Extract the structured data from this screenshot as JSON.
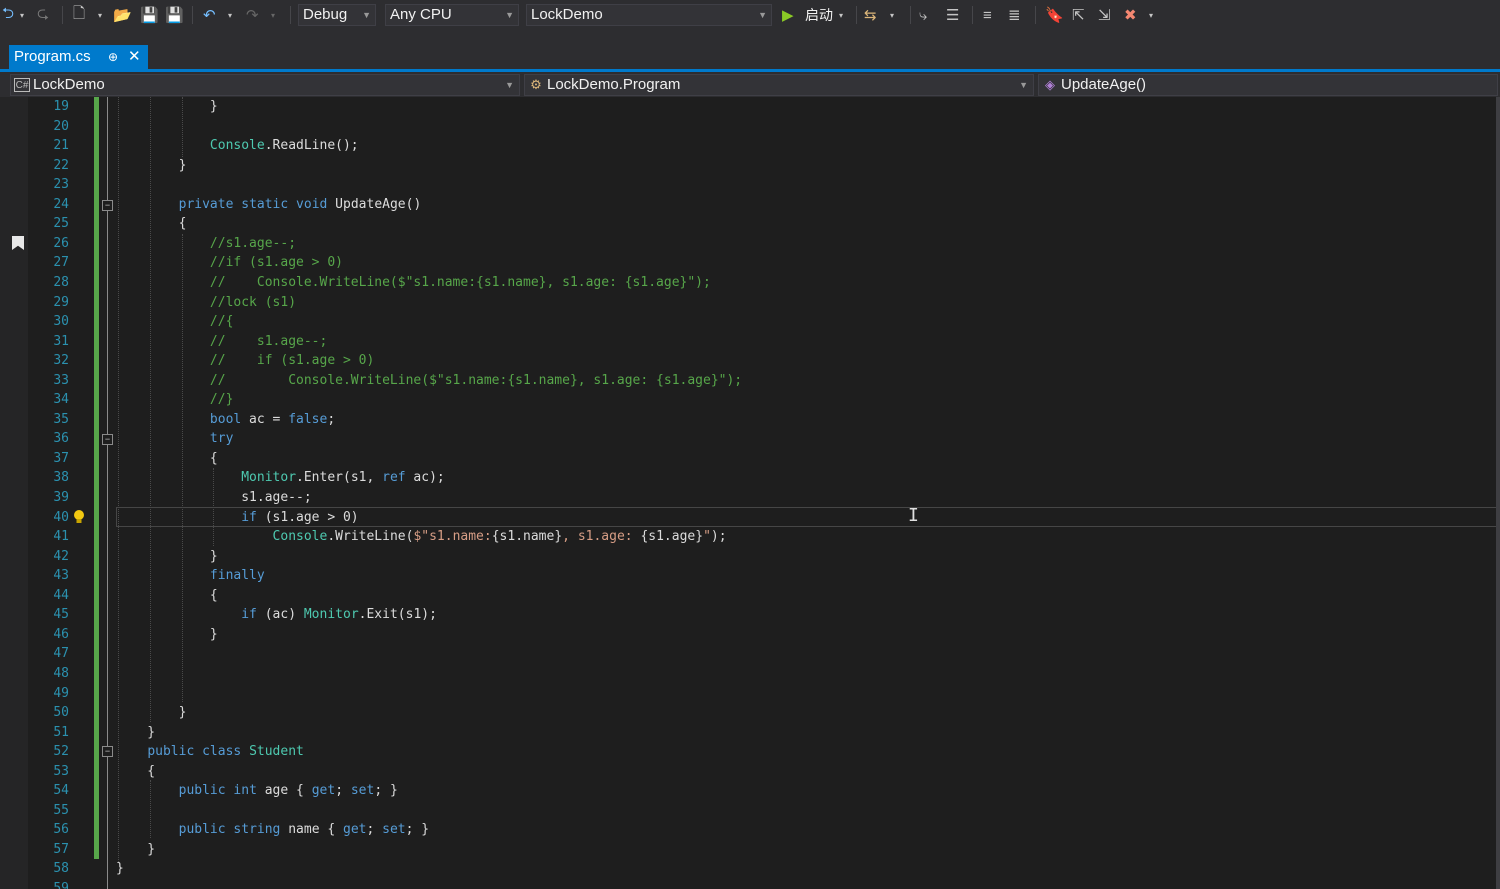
{
  "toolbar": {
    "config": "Debug",
    "platform": "Any CPU",
    "project": "LockDemo",
    "start_label": "启动"
  },
  "tab": {
    "title": "Program.cs",
    "pin": "⊕",
    "close": "✕"
  },
  "nav": {
    "project": "LockDemo",
    "type": "LockDemo.Program",
    "member": "UpdateAge()"
  },
  "lines": [
    {
      "n": "19",
      "h": "            }"
    },
    {
      "n": "20",
      "h": ""
    },
    {
      "n": "21",
      "h": "            <span class=\"t\">Console</span>.ReadLine();"
    },
    {
      "n": "22",
      "h": "        }"
    },
    {
      "n": "23",
      "h": ""
    },
    {
      "n": "24",
      "h": "        <span class=\"k\">private</span> <span class=\"k\">static</span> <span class=\"k\">void</span> UpdateAge()"
    },
    {
      "n": "25",
      "h": "        {"
    },
    {
      "n": "26",
      "h": "            <span class=\"c\">//s1.age--;</span>"
    },
    {
      "n": "27",
      "h": "            <span class=\"c\">//if (s1.age &gt; 0)</span>"
    },
    {
      "n": "28",
      "h": "            <span class=\"c\">//    Console.WriteLine($\"s1.name:{s1.name}, s1.age: {s1.age}\");</span>"
    },
    {
      "n": "29",
      "h": "            <span class=\"c\">//lock (s1)</span>"
    },
    {
      "n": "30",
      "h": "            <span class=\"c\">//{</span>"
    },
    {
      "n": "31",
      "h": "            <span class=\"c\">//    s1.age--;</span>"
    },
    {
      "n": "32",
      "h": "            <span class=\"c\">//    if (s1.age &gt; 0)</span>"
    },
    {
      "n": "33",
      "h": "            <span class=\"c\">//        Console.WriteLine($\"s1.name:{s1.name}, s1.age: {s1.age}\");</span>"
    },
    {
      "n": "34",
      "h": "            <span class=\"c\">//}</span>"
    },
    {
      "n": "35",
      "h": "            <span class=\"k\">bool</span> ac = <span class=\"k\">false</span>;"
    },
    {
      "n": "36",
      "h": "            <span class=\"k\">try</span>"
    },
    {
      "n": "37",
      "h": "            {"
    },
    {
      "n": "38",
      "h": "                <span class=\"t\">Monitor</span>.Enter(s1, <span class=\"k\">ref</span> ac);"
    },
    {
      "n": "39",
      "h": "                s1.age--;"
    },
    {
      "n": "40",
      "h": "                <span class=\"k\">if</span> (s1.age &gt; 0)"
    },
    {
      "n": "41",
      "h": "                    <span class=\"t\">Console</span>.WriteLine(<span class=\"s\">$\"s1.name:</span>{s1.name}<span class=\"s\">, s1.age: </span>{s1.age}<span class=\"s\">\"</span>);"
    },
    {
      "n": "42",
      "h": "            }"
    },
    {
      "n": "43",
      "h": "            <span class=\"k\">finally</span>"
    },
    {
      "n": "44",
      "h": "            {"
    },
    {
      "n": "45",
      "h": "                <span class=\"k\">if</span> (ac) <span class=\"t\">Monitor</span>.Exit(s1);"
    },
    {
      "n": "46",
      "h": "            }"
    },
    {
      "n": "47",
      "h": ""
    },
    {
      "n": "48",
      "h": ""
    },
    {
      "n": "49",
      "h": ""
    },
    {
      "n": "50",
      "h": "        }"
    },
    {
      "n": "51",
      "h": "    }"
    },
    {
      "n": "52",
      "h": "    <span class=\"k\">public</span> <span class=\"k\">class</span> <span class=\"t\">Student</span>"
    },
    {
      "n": "53",
      "h": "    {"
    },
    {
      "n": "54",
      "h": "        <span class=\"k\">public</span> <span class=\"k\">int</span> age { <span class=\"k\">get</span>; <span class=\"k\">set</span>; }"
    },
    {
      "n": "55",
      "h": ""
    },
    {
      "n": "56",
      "h": "        <span class=\"k\">public</span> <span class=\"k\">string</span> name { <span class=\"k\">get</span>; <span class=\"k\">set</span>; }"
    },
    {
      "n": "57",
      "h": "    }"
    },
    {
      "n": "58",
      "h": "}"
    },
    {
      "n": "59",
      "h": ""
    }
  ]
}
